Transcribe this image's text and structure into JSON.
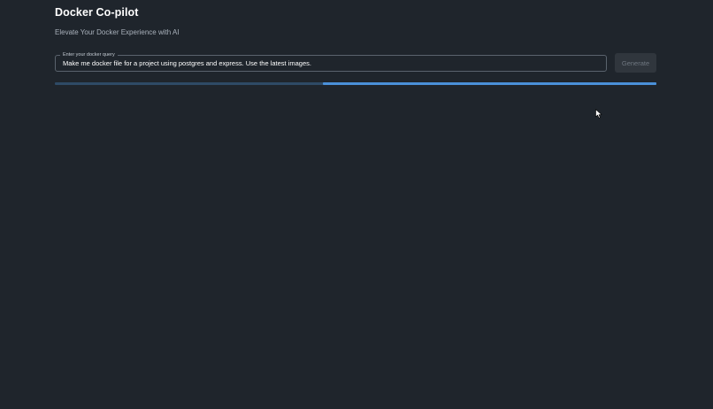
{
  "app": {
    "title": "Docker Co-pilot",
    "subtitle": "Elevate Your Docker Experience with AI"
  },
  "query": {
    "label": "Enter your docker query",
    "value": "Make me docker file for a project using postgres and express. Use the latest images."
  },
  "generate_button": {
    "label": "Generate",
    "state": "disabled"
  },
  "progress": {
    "indeterminate": true,
    "filled_start_fraction": 0.445,
    "filled_end_fraction": 1.0
  },
  "colors": {
    "background": "#1f252c",
    "accent": "#4a90d9",
    "progress_track": "#2e4a66"
  },
  "icons": {
    "cursor": "mouse-pointer-icon"
  }
}
